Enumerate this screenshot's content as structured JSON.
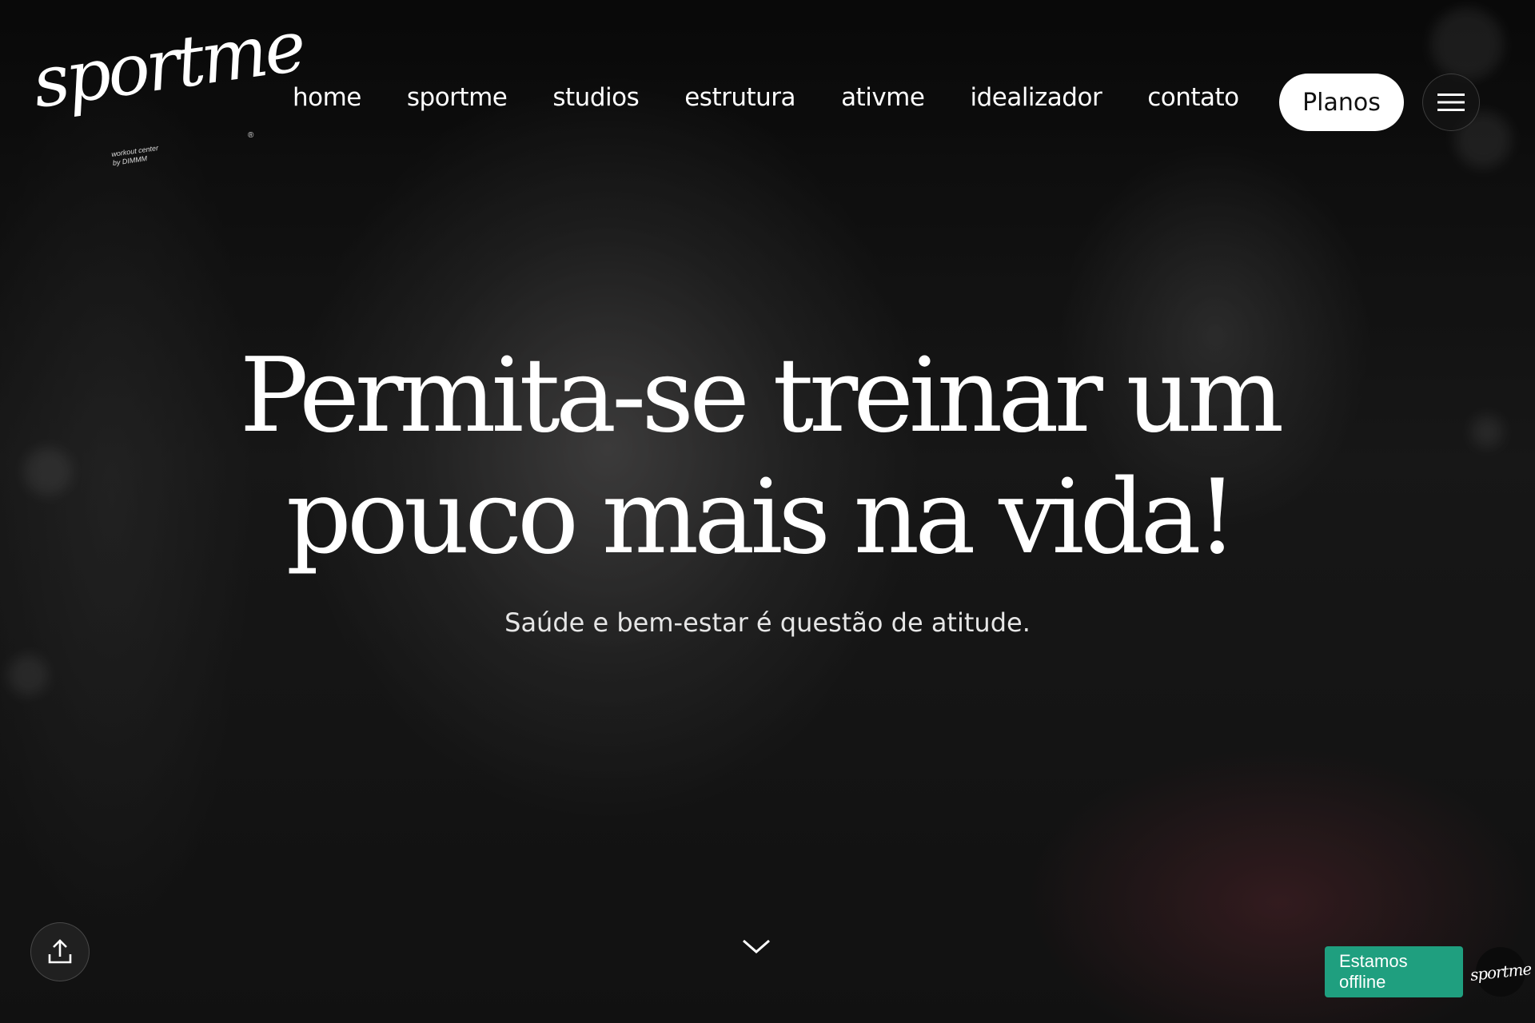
{
  "brand": {
    "logo_text": "sportme",
    "tagline_line1": "workout center",
    "tagline_line2": "by DIMMM",
    "registered": "®"
  },
  "nav": {
    "items": [
      {
        "label": "home"
      },
      {
        "label": "sportme"
      },
      {
        "label": "studios"
      },
      {
        "label": "estrutura"
      },
      {
        "label": "ativme"
      },
      {
        "label": "idealizador"
      },
      {
        "label": "contato"
      }
    ],
    "cta_label": "Planos",
    "menu_icon": "hamburger-icon"
  },
  "hero": {
    "headline_line1": "Permita-se treinar um",
    "headline_line2": "pouco mais na vida!",
    "subheadline": "Saúde e bem-estar é questão de atitude.",
    "scroll_icon": "chevron-down-icon"
  },
  "share": {
    "icon": "share-icon"
  },
  "chat": {
    "status_label": "Estamos offline",
    "avatar_text": "sportme",
    "accent_color": "#1f9f7f"
  }
}
